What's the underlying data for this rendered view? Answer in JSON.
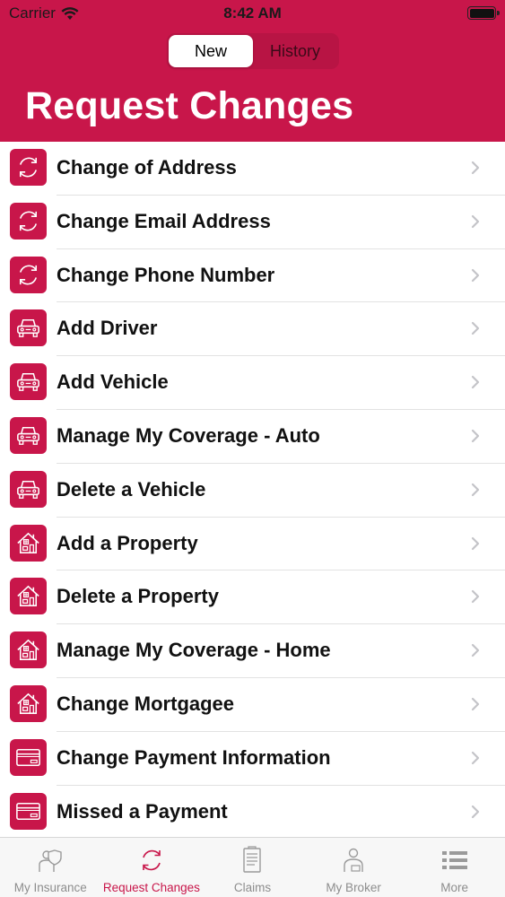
{
  "status_bar": {
    "carrier": "Carrier",
    "time": "8:42 AM"
  },
  "segments": {
    "new": "New",
    "history": "History",
    "selected": "New"
  },
  "page_title": "Request Changes",
  "items": [
    {
      "label": "Change of Address",
      "icon": "refresh-icon"
    },
    {
      "label": "Change Email Address",
      "icon": "refresh-icon"
    },
    {
      "label": "Change Phone Number",
      "icon": "refresh-icon"
    },
    {
      "label": "Add Driver",
      "icon": "car-icon"
    },
    {
      "label": "Add Vehicle",
      "icon": "car-icon"
    },
    {
      "label": "Manage My Coverage - Auto",
      "icon": "car-icon"
    },
    {
      "label": "Delete a Vehicle",
      "icon": "car-icon"
    },
    {
      "label": "Add a Property",
      "icon": "house-icon"
    },
    {
      "label": "Delete a Property",
      "icon": "house-icon"
    },
    {
      "label": "Manage My Coverage - Home",
      "icon": "house-icon"
    },
    {
      "label": "Change Mortgagee",
      "icon": "house-icon"
    },
    {
      "label": "Change Payment Information",
      "icon": "credit-card-icon"
    },
    {
      "label": "Missed a Payment",
      "icon": "credit-card-icon"
    }
  ],
  "tabs": [
    {
      "label": "My Insurance",
      "icon": "person-shield-icon",
      "active": false
    },
    {
      "label": "Request Changes",
      "icon": "refresh-icon",
      "active": true
    },
    {
      "label": "Claims",
      "icon": "document-icon",
      "active": false
    },
    {
      "label": "My Broker",
      "icon": "broker-icon",
      "active": false
    },
    {
      "label": "More",
      "icon": "list-icon",
      "active": false
    }
  ],
  "colors": {
    "brand": "#c8164a",
    "inactive_tab": "#8d8d8d"
  }
}
